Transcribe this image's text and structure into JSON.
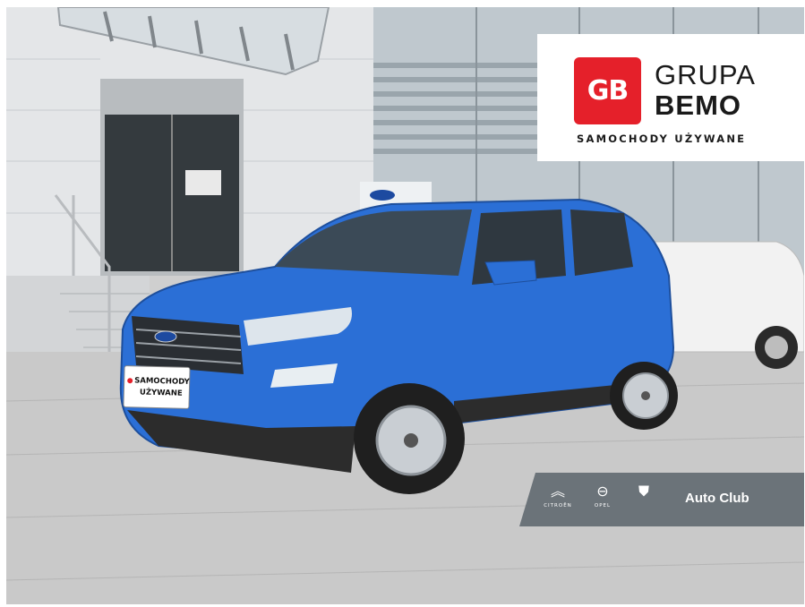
{
  "photo": {
    "subject": "blue-suv",
    "colors": {
      "car_body": "#2b6fd6",
      "sky_glass": "#cfd8de",
      "pavement": "#c9c9c9",
      "brand_red": "#e5202a",
      "banner_gray": "#6b7379"
    }
  },
  "brand": {
    "badge": "GB",
    "name_line1": "GRUPA",
    "name_line2": "BEMO",
    "subtitle": "SAMOCHODY UŻYWANE"
  },
  "plate": {
    "line1": "SAMOCHODY",
    "line2": "UŻYWANE"
  },
  "auto_club": {
    "title": "Auto Club",
    "brands": [
      "CITROËN",
      "OPEL",
      ""
    ],
    "icons": [
      "citroen-chevrons-icon",
      "opel-blitz-icon",
      "peugeot-lion-icon"
    ]
  }
}
